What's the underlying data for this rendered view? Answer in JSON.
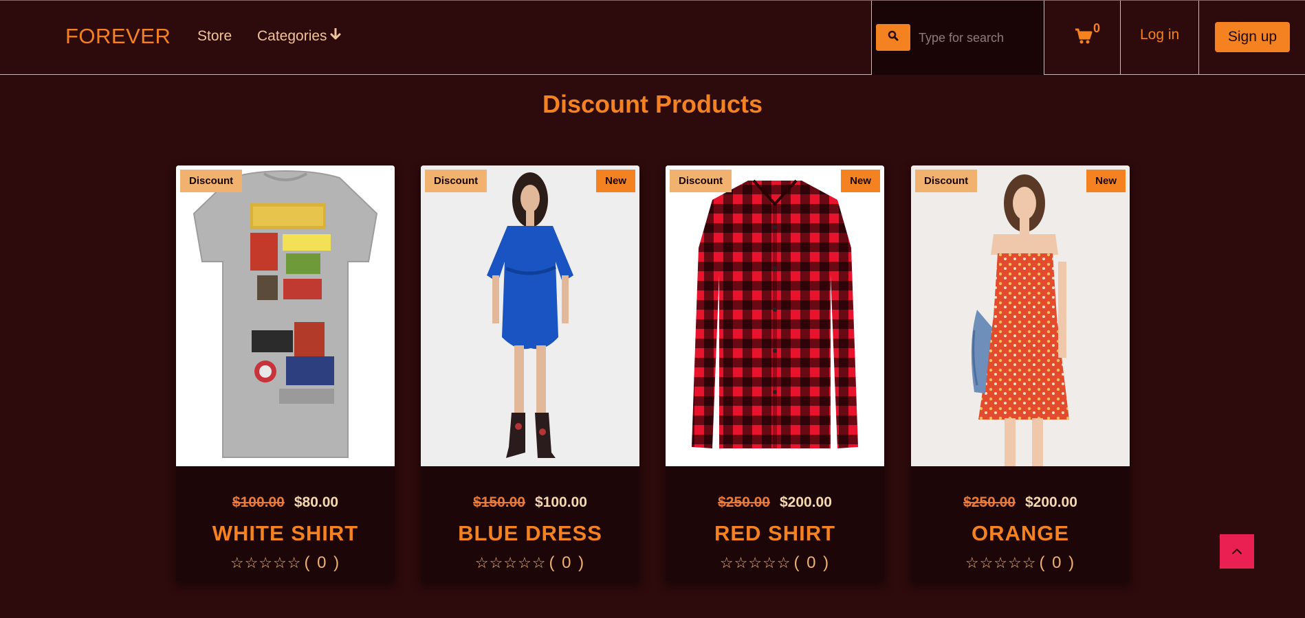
{
  "navbar": {
    "brand": "FOREVER",
    "links": {
      "store": "Store",
      "categories": "Categories"
    },
    "search": {
      "placeholder": "Type for search",
      "button_icon": "search-icon"
    },
    "cart": {
      "count": "0",
      "icon": "cart-icon"
    },
    "login_label": "Log in",
    "signup_label": "Sign up"
  },
  "section": {
    "title": "Discount Products"
  },
  "products": [
    {
      "name": "WHITE SHIRT",
      "old_price": "$100.00",
      "price": "$80.00",
      "badge_discount": "Discount",
      "badge_new": "",
      "rating_stars": 0,
      "rating_count": "( 0 )",
      "image": "graphic-tshirt-image"
    },
    {
      "name": "BLUE DRESS",
      "old_price": "$150.00",
      "price": "$100.00",
      "badge_discount": "Discount",
      "badge_new": "New",
      "rating_stars": 0,
      "rating_count": "( 0 )",
      "image": "blue-dress-image"
    },
    {
      "name": "RED SHIRT",
      "old_price": "$250.00",
      "price": "$200.00",
      "badge_discount": "Discount",
      "badge_new": "New",
      "rating_stars": 0,
      "rating_count": "( 0 )",
      "image": "red-plaid-shirt-image"
    },
    {
      "name": "ORANGE",
      "old_price": "$250.00",
      "price": "$200.00",
      "badge_discount": "Discount",
      "badge_new": "New",
      "rating_stars": 0,
      "rating_count": "( 0 )",
      "image": "orange-floral-dress-image"
    }
  ],
  "scroll_top_icon": "chevron-up-icon",
  "colors": {
    "background": "#2d0a0b",
    "accent": "#f58220",
    "badge_discount": "#f0b26e",
    "scroll_top": "#ea1f52"
  }
}
